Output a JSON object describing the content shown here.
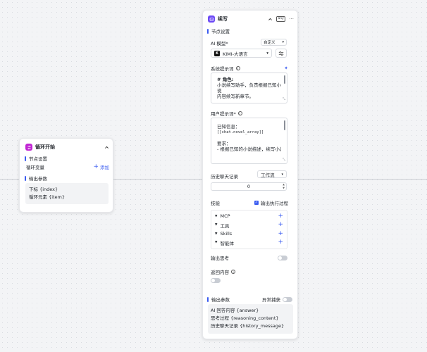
{
  "loop_node": {
    "title": "循环开始",
    "section_settings": "节点设置",
    "loop_var_label": "循环变量",
    "add_label": "添加",
    "section_output": "输出参数",
    "outputs": [
      "下标 {index}",
      "循环元素 {item}"
    ]
  },
  "write_node": {
    "title": "续写",
    "badge": "any",
    "section_settings": "节点设置",
    "ai_model_label": "AI 模型*",
    "custom_label": "自定义",
    "model_name": "KIMI-大语言",
    "system_prompt_label": "系统提示词",
    "system_prompt_lines": [
      "# 角色:",
      "小说续写助手，负责根据已知小说",
      "内容续写新章节。"
    ],
    "user_prompt_label": "用户提示词*",
    "user_prompt_lines": [
      "已知信息：",
      "[[chat.novel_array]]",
      "",
      "要求：",
      "- 根据已知的小说描述，续写小说"
    ],
    "history_label": "历史聊天记录",
    "history_mode": "工作流",
    "history_value": "0",
    "skills_label": "技能",
    "output_process_label": "输出执行过程",
    "skills": [
      "MCP",
      "工具",
      "Skills",
      "智能体"
    ],
    "output_thinking_label": "输出思考",
    "return_content_label": "返回内容",
    "section_output": "输出参数",
    "exception_label": "异常捕获",
    "outputs": [
      "AI 回答内容 {answer}",
      "思考过程 {reasoning_content}",
      "历史聊天记录 {history_message}"
    ]
  },
  "colors": {
    "accent": "#3b5cf0",
    "loop_icon_bg": "#c026d3",
    "write_icon_bg": "#6d4af5"
  }
}
